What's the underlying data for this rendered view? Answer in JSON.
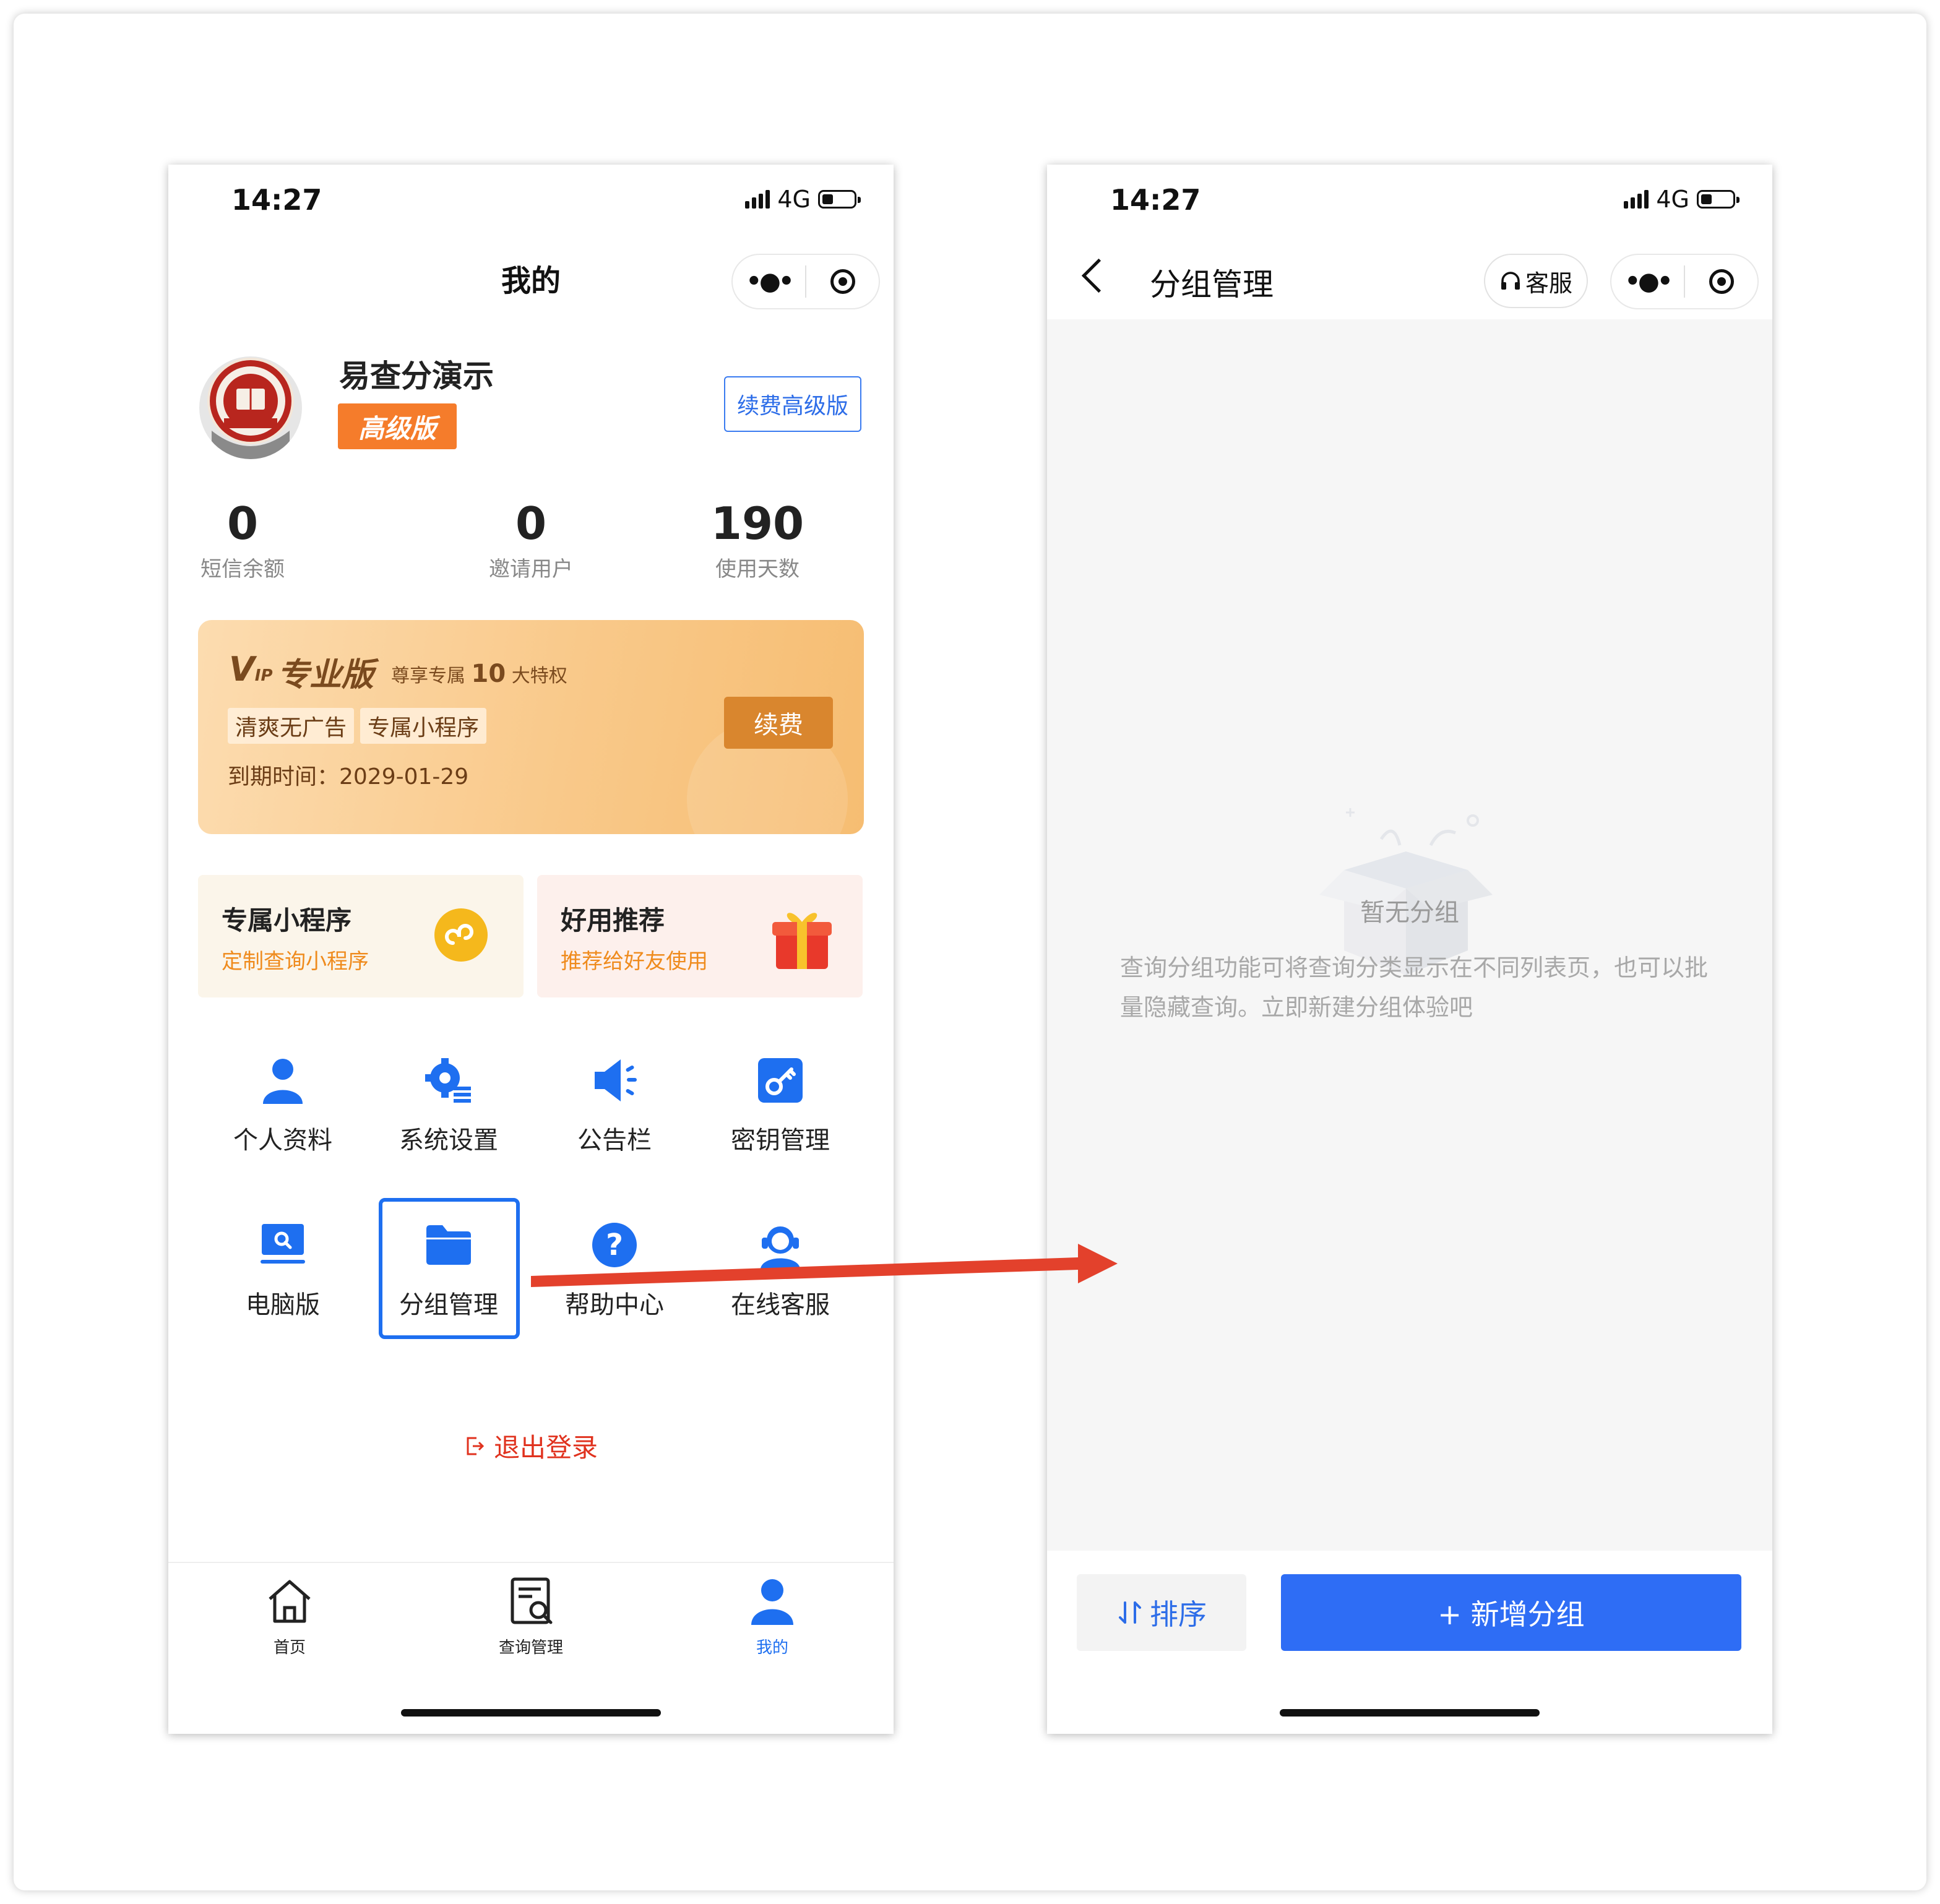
{
  "colors": {
    "accent_blue": "#2d6de8",
    "badge_orange": "#f57c2b",
    "logout_red": "#e0321e",
    "arrow_red": "#e3412c",
    "vip_gold": "#d9862e"
  },
  "left_phone": {
    "status": {
      "time": "14:27",
      "network": "4G"
    },
    "title": "我的",
    "capsule": {
      "more_icon": "more-dots-icon",
      "close_icon": "target-icon"
    },
    "profile": {
      "name": "易查分演示",
      "level": "高级版",
      "renew_button": "续费高级版",
      "avatar_icon": "school-seal-logo"
    },
    "stats": [
      {
        "value": "0",
        "label": "短信余额"
      },
      {
        "value": "0",
        "label": "邀请用户"
      },
      {
        "value": "190",
        "label": "使用天数"
      }
    ],
    "vip": {
      "logo": "V",
      "logo_sub": "IP",
      "title": "专业版",
      "sub_prefix": "尊享专属",
      "sub_number": "10",
      "sub_suffix": "大特权",
      "tags": [
        "清爽无广告",
        "专属小程序"
      ],
      "expire": "到期时间：2029-01-29",
      "renew_button": "续费"
    },
    "promos": [
      {
        "title": "专属小程序",
        "subtitle": "定制查询小程序",
        "icon": "mini-program-icon"
      },
      {
        "title": "好用推荐",
        "subtitle": "推荐给好友使用",
        "icon": "gift-icon"
      }
    ],
    "grid": [
      {
        "label": "个人资料",
        "icon": "person-icon"
      },
      {
        "label": "系统设置",
        "icon": "settings-gear-icon"
      },
      {
        "label": "公告栏",
        "icon": "megaphone-icon"
      },
      {
        "label": "密钥管理",
        "icon": "key-icon"
      },
      {
        "label": "电脑版",
        "icon": "computer-icon"
      },
      {
        "label": "分组管理",
        "icon": "folder-icon"
      },
      {
        "label": "帮助中心",
        "icon": "help-icon"
      },
      {
        "label": "在线客服",
        "icon": "customer-service-icon"
      }
    ],
    "logout": "退出登录",
    "tabs": [
      {
        "label": "首页",
        "icon": "home-icon"
      },
      {
        "label": "查询管理",
        "icon": "query-manage-icon"
      },
      {
        "label": "我的",
        "icon": "user-icon"
      }
    ]
  },
  "right_phone": {
    "status": {
      "time": "14:27",
      "network": "4G"
    },
    "title": "分组管理",
    "service_button": "客服",
    "empty": {
      "title": "暂无分组",
      "description": "查询分组功能可将查询分类显示在不同列表页，也可以批量隐藏查询。立即新建分组体验吧",
      "icon": "empty-box-icon"
    },
    "sort_button": "排序",
    "add_button": "+ 新增分组"
  }
}
